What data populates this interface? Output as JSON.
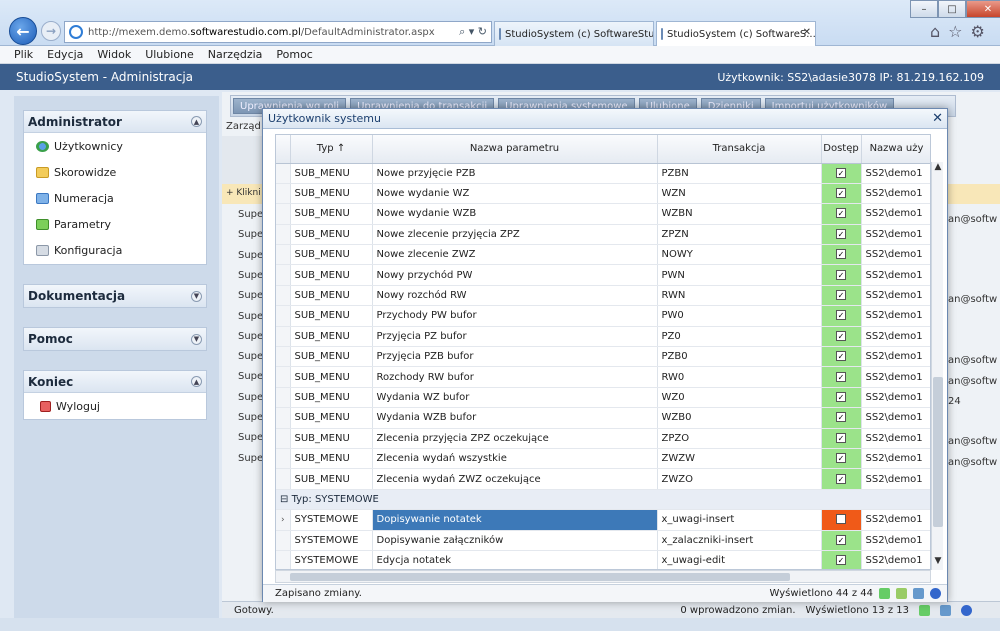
{
  "browser": {
    "url_prefix": "http://mexem.demo.",
    "url_host": "softwarestudio.com.pl",
    "url_path": "/DefaultAdministrator.aspx",
    "tabs": [
      {
        "label": "StudioSystem (c) SoftwareStud..."
      },
      {
        "label": "StudioSystem (c) SoftwareS..."
      }
    ]
  },
  "menu": [
    "Plik",
    "Edycja",
    "Widok",
    "Ulubione",
    "Narzędzia",
    "Pomoc"
  ],
  "app": {
    "title": "StudioSystem - Administracja",
    "user_info": "Użytkownik: SS2\\adasie3078 IP: 81.219.162.109"
  },
  "sidebar": {
    "administrator": {
      "title": "Administrator",
      "items": [
        "Użytkownicy",
        "Skorowidze",
        "Numeracja",
        "Parametry",
        "Konfiguracja"
      ]
    },
    "dokumentacja": {
      "title": "Dokumentacja"
    },
    "pomoc": {
      "title": "Pomoc"
    },
    "koniec": {
      "title": "Koniec",
      "items": [
        "Wyloguj"
      ]
    }
  },
  "background": {
    "toolbar": [
      "Uprawnienia wg roli",
      "Uprawnienia do transakcji",
      "Uprawnienia systemowe",
      "Ulubione",
      "Dzienniki",
      "Importuj użytkowników"
    ],
    "tab_fragment": "Zarząd",
    "add_row": "Klikni",
    "rows": [
      "Supe",
      "Supe",
      "Supe",
      "Supe",
      "Supe",
      "Supe",
      "Supe",
      "Supe",
      "Supe",
      "Supe",
      "Supe",
      "Supe",
      "Supe"
    ],
    "right_fragments": [
      "an@softw",
      "an@softw",
      "an@softw",
      "an@softw",
      "24",
      "an@softw",
      "an@softw"
    ],
    "status_left": "Gotowy.",
    "status_mid": "0 wprowadzono zmian.",
    "status_right": "Wyświetlono 13 z 13"
  },
  "dialog": {
    "title": "Użytkownik systemu",
    "columns": {
      "typ": "Typ",
      "sort": "↑",
      "nazwa": "Nazwa parametru",
      "transakcja": "Transakcja",
      "dostep": "Dostęp",
      "nazwa_u": "Nazwa uży"
    },
    "rows": [
      {
        "typ": "SUB_MENU",
        "nazwa": "Nowe przyjęcie PZB",
        "trans": "PZBN",
        "dostep": true,
        "user": "SS2\\demo1"
      },
      {
        "typ": "SUB_MENU",
        "nazwa": "Nowe wydanie WZ",
        "trans": "WZN",
        "dostep": true,
        "user": "SS2\\demo1"
      },
      {
        "typ": "SUB_MENU",
        "nazwa": "Nowe wydanie WZB",
        "trans": "WZBN",
        "dostep": true,
        "user": "SS2\\demo1"
      },
      {
        "typ": "SUB_MENU",
        "nazwa": "Nowe zlecenie przyjęcia ZPZ",
        "trans": "ZPZN",
        "dostep": true,
        "user": "SS2\\demo1"
      },
      {
        "typ": "SUB_MENU",
        "nazwa": "Nowe zlecenie ZWZ",
        "trans": "NOWY",
        "dostep": true,
        "user": "SS2\\demo1"
      },
      {
        "typ": "SUB_MENU",
        "nazwa": "Nowy przychód PW",
        "trans": "PWN",
        "dostep": true,
        "user": "SS2\\demo1"
      },
      {
        "typ": "SUB_MENU",
        "nazwa": "Nowy rozchód RW",
        "trans": "RWN",
        "dostep": true,
        "user": "SS2\\demo1"
      },
      {
        "typ": "SUB_MENU",
        "nazwa": "Przychody PW bufor",
        "trans": "PW0",
        "dostep": true,
        "user": "SS2\\demo1"
      },
      {
        "typ": "SUB_MENU",
        "nazwa": "Przyjęcia PZ bufor",
        "trans": "PZ0",
        "dostep": true,
        "user": "SS2\\demo1"
      },
      {
        "typ": "SUB_MENU",
        "nazwa": "Przyjęcia PZB bufor",
        "trans": "PZB0",
        "dostep": true,
        "user": "SS2\\demo1"
      },
      {
        "typ": "SUB_MENU",
        "nazwa": "Rozchody RW bufor",
        "trans": "RW0",
        "dostep": true,
        "user": "SS2\\demo1"
      },
      {
        "typ": "SUB_MENU",
        "nazwa": "Wydania WZ bufor",
        "trans": "WZ0",
        "dostep": true,
        "user": "SS2\\demo1"
      },
      {
        "typ": "SUB_MENU",
        "nazwa": "Wydania WZB bufor",
        "trans": "WZB0",
        "dostep": true,
        "user": "SS2\\demo1"
      },
      {
        "typ": "SUB_MENU",
        "nazwa": "Zlecenia przyjęcia ZPZ oczekujące",
        "trans": "ZPZO",
        "dostep": true,
        "user": "SS2\\demo1"
      },
      {
        "typ": "SUB_MENU",
        "nazwa": "Zlecenia wydań wszystkie",
        "trans": "ZWZW",
        "dostep": true,
        "user": "SS2\\demo1"
      },
      {
        "typ": "SUB_MENU",
        "nazwa": "Zlecenia wydań ZWZ oczekujące",
        "trans": "ZWZO",
        "dostep": true,
        "user": "SS2\\demo1"
      }
    ],
    "group_label": "Typ: SYSTEMOWE",
    "group_rows": [
      {
        "typ": "SYSTEMOWE",
        "nazwa": "Dopisywanie notatek",
        "trans": "x_uwagi-insert",
        "dostep": false,
        "user": "SS2\\demo1",
        "selected": true
      },
      {
        "typ": "SYSTEMOWE",
        "nazwa": "Dopisywanie załączników",
        "trans": "x_zalaczniki-insert",
        "dostep": true,
        "user": "SS2\\demo1"
      },
      {
        "typ": "SYSTEMOWE",
        "nazwa": "Edycja notatek",
        "trans": "x_uwagi-edit",
        "dostep": true,
        "user": "SS2\\demo1"
      }
    ],
    "status_left": "Zapisano zmiany.",
    "status_right": "Wyświetlono 44 z 44"
  },
  "colors": {
    "header": "#3b5e8c",
    "access_on": "#9be38a",
    "access_off": "#f05a18",
    "selected": "#3d79b8"
  }
}
